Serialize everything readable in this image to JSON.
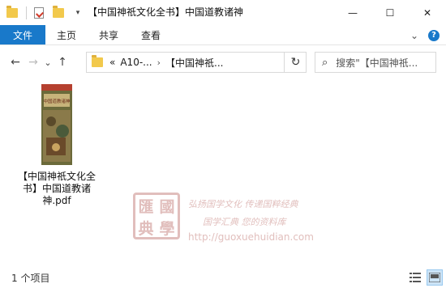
{
  "window": {
    "title": "【中国神祇文化全书】中国道教诸神",
    "minimize_glyph": "—",
    "maximize_glyph": "☐",
    "close_glyph": "✕"
  },
  "quick_access": {
    "dropdown_glyph": "▾"
  },
  "ribbon": {
    "tabs": [
      "文件",
      "主页",
      "共享",
      "查看"
    ],
    "collapse_glyph": "⌄",
    "help_glyph": "?"
  },
  "nav": {
    "back_glyph": "←",
    "forward_glyph": "→",
    "recent_glyph": "⌄",
    "up_glyph": "↑",
    "refresh_glyph": "↻",
    "breadcrumb": {
      "overflow": "«",
      "segments": [
        "A10-...",
        "【中国神祇..."
      ],
      "separator": "›"
    },
    "search_placeholder": "搜索\"【中国神祇...",
    "search_glyph": "⌕"
  },
  "files": [
    {
      "name": "【中国神祇文化全书】中国道教诸神.pdf",
      "type": "pdf",
      "thumbnail_title": "中国道教诸神",
      "thumbnail_colors": {
        "cover": "#6b6a3a",
        "band": "#b5402f",
        "art": "#8a7a4a"
      }
    }
  ],
  "watermark": {
    "seal_chars": [
      "匯",
      "國",
      "典",
      "學"
    ],
    "line1": "弘扬国学文化 传递国粹经典",
    "line2": "国学汇典 您的资料库",
    "url": "http://guoxuehuidian.com"
  },
  "status": {
    "item_count": "1 个项目"
  },
  "colors": {
    "accent": "#1979ca",
    "watermark": "#c98a86"
  }
}
